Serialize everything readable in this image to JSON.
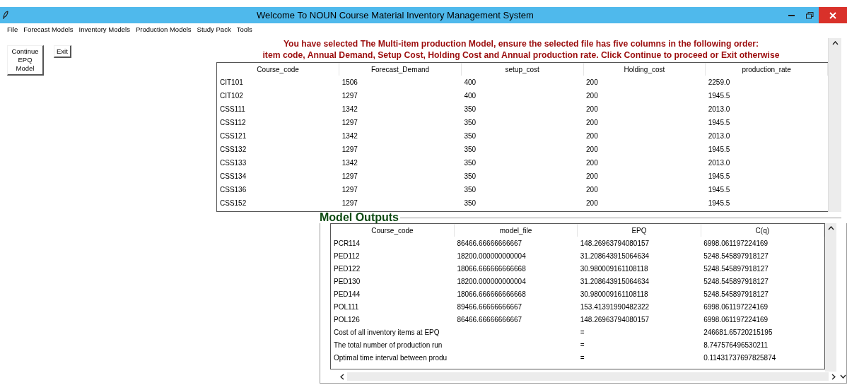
{
  "window": {
    "title": "Welcome To NOUN Course Material Inventory Management System"
  },
  "menu": [
    "File",
    "Forecast Models",
    "Inventory Models",
    "Production Models",
    "Study Pack",
    "Tools"
  ],
  "message": [
    "You have selected The Multi-item production Model, ensure the selected file has five columns in the following order:",
    "item code, Annual Demand, Setup Cost, Holding Cost and Annual production rate.  Click Continue to proceed or Exit otherwise"
  ],
  "buttons": [
    "Continue EPQ Model",
    "Exit"
  ],
  "input_table": {
    "columns": [
      "Course_code",
      "Forecast_Demand",
      "setup_cost",
      "Holding_cost",
      "production_rate"
    ],
    "rows": [
      [
        "CIT101",
        "1506",
        "400",
        "200",
        "2259.0"
      ],
      [
        "CIT102",
        "1297",
        "400",
        "200",
        "1945.5"
      ],
      [
        "CSS111",
        "1342",
        "350",
        "200",
        "2013.0"
      ],
      [
        "CSS112",
        "1297",
        "350",
        "200",
        "1945.5"
      ],
      [
        "CSS121",
        "1342",
        "350",
        "200",
        "2013.0"
      ],
      [
        "CSS132",
        "1297",
        "350",
        "200",
        "1945.5"
      ],
      [
        "CSS133",
        "1342",
        "350",
        "200",
        "2013.0"
      ],
      [
        "CSS134",
        "1297",
        "350",
        "200",
        "1945.5"
      ],
      [
        "CSS136",
        "1297",
        "350",
        "200",
        "1945.5"
      ],
      [
        "CSS152",
        "1297",
        "350",
        "200",
        "1945.5"
      ]
    ]
  },
  "model_outputs": {
    "title": "Model Outputs",
    "columns": [
      "Course_code",
      "model_file",
      "EPQ",
      "C(q)"
    ],
    "rows": [
      [
        "PCR114",
        "86466.66666666667",
        "148.26963794080157",
        "6998.061197224169"
      ],
      [
        "PED112",
        "18200.000000000004",
        "31.208643915064634",
        "5248.545897918127"
      ],
      [
        "PED122",
        "18066.666666666668",
        "30.980009161108118",
        "5248.545897918127"
      ],
      [
        "PED130",
        "18200.000000000004",
        "31.208643915064634",
        "5248.545897918127"
      ],
      [
        "PED144",
        "18066.666666666668",
        "30.980009161108118",
        "5248.545897918127"
      ],
      [
        "POL111",
        "89466.66666666667",
        "153.41391990482322",
        "6998.061197224169"
      ],
      [
        "POL126",
        "86466.66666666667",
        "148.26963794080157",
        "6998.061197224169"
      ],
      [
        "Cost of all inventory items at EPQ",
        "",
        "=",
        "246681.65720215195"
      ],
      [
        "The total number of production run",
        "",
        "=",
        "8.747576496530211"
      ],
      [
        "Optimal time interval between produ",
        "",
        "=",
        "0.11431737697825874"
      ]
    ]
  }
}
